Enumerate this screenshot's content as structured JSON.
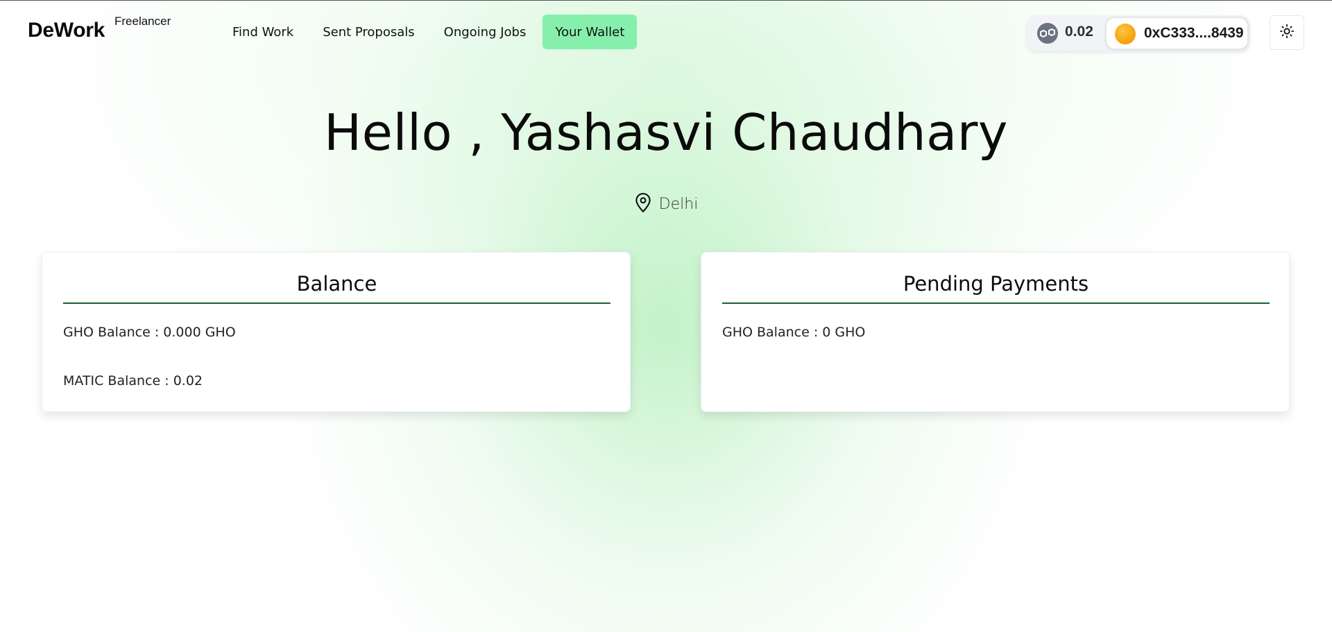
{
  "header": {
    "brand": "DeWork",
    "brand_sub": "Freelancer",
    "nav": [
      {
        "label": "Find Work",
        "active": false
      },
      {
        "label": "Sent Proposals",
        "active": false
      },
      {
        "label": "Ongoing Jobs",
        "active": false
      },
      {
        "label": "Your Wallet",
        "active": true
      }
    ],
    "wallet": {
      "chain_icon": "polygon-matic-icon",
      "balance": "0.02",
      "account": "0xC333....8439"
    },
    "theme_icon": "sun-icon"
  },
  "hero": {
    "greeting": "Hello , Yashasvi Chaudhary",
    "location_icon": "map-pin-icon",
    "location": "Delhi"
  },
  "cards": {
    "balance": {
      "title": "Balance",
      "gho": "GHO Balance : 0.000 GHO",
      "matic": "MATIC Balance : 0.02"
    },
    "pending": {
      "title": "Pending Payments",
      "gho": "GHO Balance : 0 GHO"
    }
  },
  "colors": {
    "active_nav": "#86efac",
    "title_underline": "#1b5e34",
    "avatar": "#f59e0b"
  }
}
